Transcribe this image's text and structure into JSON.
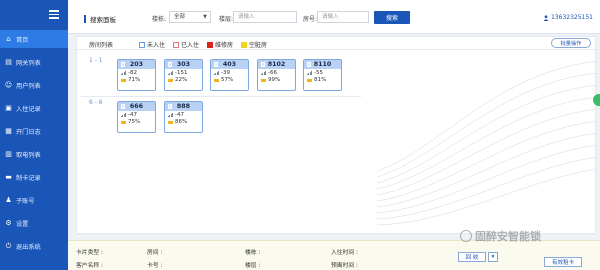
{
  "sidebar": {
    "items": [
      {
        "label": "首页",
        "icon": "home-icon",
        "active": true
      },
      {
        "label": "网关列表",
        "icon": "gateway-icon"
      },
      {
        "label": "用户列表",
        "icon": "user-icon"
      },
      {
        "label": "入住记录",
        "icon": "checkin-icon"
      },
      {
        "label": "开门日志",
        "icon": "door-log-icon"
      },
      {
        "label": "取电列表",
        "icon": "power-icon"
      },
      {
        "label": "制卡记录",
        "icon": "card-icon"
      },
      {
        "label": "子账号",
        "icon": "subaccount-icon"
      },
      {
        "label": "设置",
        "icon": "gear-icon"
      },
      {
        "label": "退出系统",
        "icon": "logout-icon"
      }
    ]
  },
  "topbar": {
    "title": "搜索面板",
    "building_label": "楼栋:",
    "building_value": "全部",
    "floor_label": "楼层:",
    "floor_placeholder": "请输入",
    "room_label": "房号:",
    "room_placeholder": "请输入",
    "search_button": "搜索",
    "user_phone": "13632325151"
  },
  "panel": {
    "title": "房间列表",
    "legend": [
      {
        "label": "未入住",
        "color": "#ffffff",
        "border": "#6aa0e0"
      },
      {
        "label": "已入住",
        "color": "#ffffff",
        "border": "#e07a7a"
      },
      {
        "label": "维修房",
        "color": "#d9261c",
        "border": "#d9261c"
      },
      {
        "label": "空脏房",
        "color": "#f3d21a",
        "border": "#f3d21a"
      }
    ],
    "batch_button": "批量操作",
    "floors": [
      {
        "label": "1 - 1",
        "rooms": [
          {
            "num": "203",
            "signal": "-82",
            "battery": "71%"
          },
          {
            "num": "303",
            "signal": "-151",
            "battery": "22%"
          },
          {
            "num": "403",
            "signal": "-39",
            "battery": "57%"
          },
          {
            "num": "8102",
            "signal": "-66",
            "battery": "99%"
          },
          {
            "num": "8110",
            "signal": "-55",
            "battery": "81%"
          }
        ]
      },
      {
        "label": "6 - 6",
        "rooms": [
          {
            "num": "666",
            "signal": "-47",
            "battery": "75%"
          },
          {
            "num": "888",
            "signal": "-47",
            "battery": "86%"
          }
        ]
      }
    ]
  },
  "bottom": {
    "card_type": "卡片类型 :",
    "room": "房间 :",
    "building": "楼栋 :",
    "checkin_time": "入住时间 :",
    "customer_name": "客户名称 :",
    "card_no": "卡号 :",
    "floor": "楼层 :",
    "checkout_time": "预离时间 :",
    "recycle_button": "回 收",
    "dropdown_caret": "▾",
    "valid_card_button": "有效租卡"
  },
  "watermark": "固醉安智能锁",
  "colors": {
    "sidebar": "#1a55b8",
    "active": "#2e7be6",
    "card_header": "#b9d2f3",
    "battery": "#f0b31a"
  }
}
